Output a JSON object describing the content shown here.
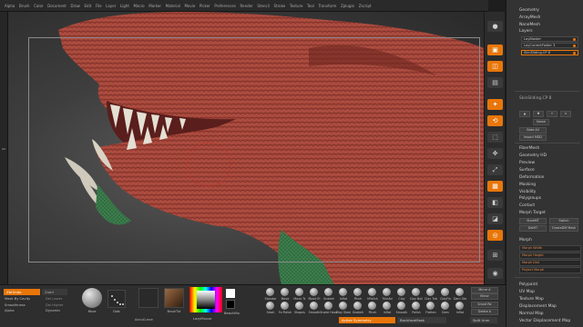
{
  "menu": [
    "Alpha",
    "Brush",
    "Color",
    "Document",
    "Draw",
    "Edit",
    "File",
    "Layer",
    "Light",
    "Macro",
    "Marker",
    "Material",
    "Movie",
    "Picker",
    "Preferences",
    "Render",
    "Stencil",
    "Stroke",
    "Texture",
    "Tool",
    "Transform",
    "Zplugin",
    "Zscript"
  ],
  "coordinate_readout": "0.98,-0.582,-0.695",
  "tray": {
    "geometry": "Geometry",
    "arraymesh": "ArrayMesh",
    "nanomesh": "NanoMesh",
    "layers": "Layers",
    "layer_rows": [
      "LayBlaster",
      "LayCurrentFolder 3",
      "SkinSliding.CP 8"
    ],
    "active_layer": "SkinSliding.CP 8",
    "layer_buttons": [
      "Name",
      "Bake All",
      "Import MDD"
    ],
    "fibermesh": "FiberMesh",
    "geometry_hd": "Geometry HD",
    "preview": "Preview",
    "surface": "Surface",
    "deformation": "Deformation",
    "masking": "Masking",
    "visibility": "Visibility",
    "polygroups": "Polygroups",
    "contact": "Contact",
    "morph_target": "Morph Target",
    "morph_buttons": [
      "StoreMT",
      "Switch",
      "DelMT",
      "CreateDiff Mesh"
    ],
    "morph": "Morph",
    "sliders": [
      {
        "label": "Morph Width",
        "value": 0.0
      },
      {
        "label": "Morph Height",
        "value": 0.0
      },
      {
        "label": "Morph Dist",
        "value": 0.0
      },
      {
        "label": "Project Morph",
        "value": 0.0
      }
    ],
    "polypaint": "Polypaint",
    "uv_map": "UV Map",
    "texture_map": "Texture Map",
    "displacement_map": "Displacement Map",
    "normal_map": "Normal Map",
    "vector_displacement_map": "Vector Displacement Map"
  },
  "shelf": {
    "draw_mode": "ZbrUndo",
    "draw_mode_alt": "Zadd",
    "mask_by_cavity": "Mask By Cavity",
    "del_lower": "Del Lower",
    "smoothness": "Smoothness",
    "del_higher": "Del Higher",
    "alpha_label": "Alpha",
    "dynamic": "Dynamic",
    "brushes_main": [
      {
        "name": "Move"
      },
      {
        "name": "Dots"
      }
    ],
    "accucurve": "AccuCurve",
    "brush_alpha": "BrushTxt",
    "lazymouse": "LazyMouse",
    "beachmo": "BeachMo",
    "brush_grid": [
      "Standar",
      "Move",
      "Move Tc",
      "Move El",
      "Snakeh",
      "Inflat",
      "Pinch",
      "hPolish",
      "TrimAd",
      "Clay",
      "Clay Buil",
      "Clay Tub",
      "ClayFin",
      "Dam Sta",
      "LC Snake",
      "Spiral",
      "MAH Curve",
      "Creation",
      "Smooth",
      "Mask"
    ],
    "brush_grid_row2": [
      "Slash",
      "Fo Polish",
      "Shapes",
      "Smooth",
      "Snake Hook",
      "Clay Slam",
      "Snakeh",
      "Pinch",
      "Inflat",
      "Smooth",
      "Polish",
      "Flatten",
      "Dam",
      "Inflat"
    ],
    "mirror_buttons": [
      "Mirror A",
      "Mirror",
      "Smart Re",
      "Delete A",
      "Split Unm"
    ],
    "actions": [
      "Active Symmetry",
      "BackfaceMask",
      "Split Unm"
    ]
  },
  "colors": {
    "accent": "#e8760a",
    "skin": "#9c3d33",
    "green": "#3c7e4d",
    "tooth": "#e4e0d4"
  }
}
